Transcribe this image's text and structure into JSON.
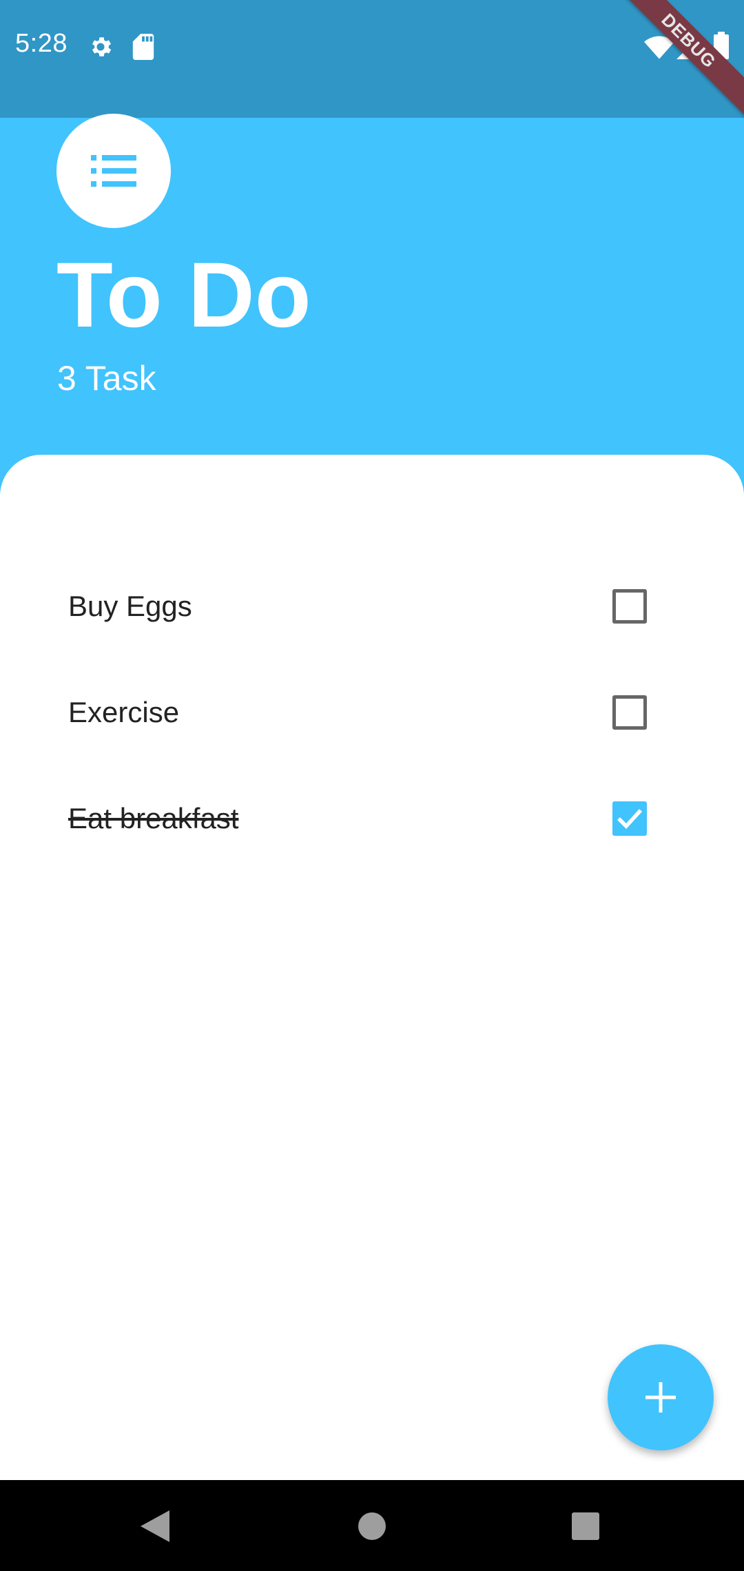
{
  "status_bar": {
    "time": "5:28",
    "icons": [
      "gear-icon",
      "sdcard-icon",
      "wifi-icon",
      "signal-icon",
      "battery-icon"
    ],
    "debug_banner": "DEBUG"
  },
  "header": {
    "icon": "list-icon",
    "title": "To Do",
    "task_count": "3 Task"
  },
  "tasks": [
    {
      "label": "Buy Eggs",
      "done": false
    },
    {
      "label": "Exercise",
      "done": false
    },
    {
      "label": "Eat breakfast",
      "done": true
    }
  ],
  "fab": {
    "icon": "plus-icon"
  },
  "nav_bar": {
    "icons": [
      "back-icon",
      "home-icon",
      "recents-icon"
    ]
  },
  "colors": {
    "accent": "#41C3FD",
    "status_bar": "#3096C5",
    "card": "#FFFFFF",
    "text": "#222222"
  }
}
